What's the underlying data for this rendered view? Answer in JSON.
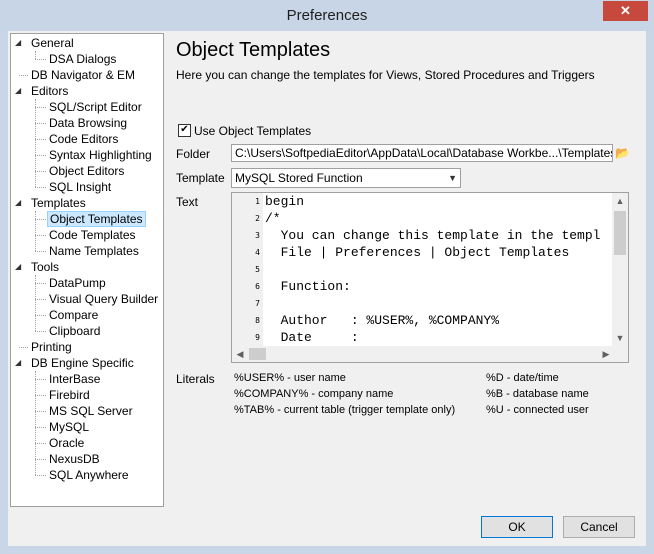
{
  "window": {
    "title": "Preferences",
    "close_glyph": "✕"
  },
  "tree": {
    "items": [
      {
        "label": "General",
        "level": 0,
        "expanded": true
      },
      {
        "label": "DSA Dialogs",
        "level": 1
      },
      {
        "label": "DB Navigator & EM",
        "level": 0
      },
      {
        "label": "Editors",
        "level": 0,
        "expanded": true
      },
      {
        "label": "SQL/Script Editor",
        "level": 1
      },
      {
        "label": "Data Browsing",
        "level": 1
      },
      {
        "label": "Code Editors",
        "level": 1
      },
      {
        "label": "Syntax Highlighting",
        "level": 1
      },
      {
        "label": "Object Editors",
        "level": 1
      },
      {
        "label": "SQL Insight",
        "level": 1
      },
      {
        "label": "Templates",
        "level": 0,
        "expanded": true
      },
      {
        "label": "Object Templates",
        "level": 1,
        "selected": true
      },
      {
        "label": "Code Templates",
        "level": 1
      },
      {
        "label": "Name Templates",
        "level": 1
      },
      {
        "label": "Tools",
        "level": 0,
        "expanded": true
      },
      {
        "label": "DataPump",
        "level": 1
      },
      {
        "label": "Visual Query Builder",
        "level": 1
      },
      {
        "label": "Compare",
        "level": 1
      },
      {
        "label": "Clipboard",
        "level": 1
      },
      {
        "label": "Printing",
        "level": 0
      },
      {
        "label": "DB Engine Specific",
        "level": 0,
        "expanded": true
      },
      {
        "label": "InterBase",
        "level": 1
      },
      {
        "label": "Firebird",
        "level": 1
      },
      {
        "label": "MS SQL Server",
        "level": 1
      },
      {
        "label": "MySQL",
        "level": 1
      },
      {
        "label": "Oracle",
        "level": 1
      },
      {
        "label": "NexusDB",
        "level": 1
      },
      {
        "label": "SQL Anywhere",
        "level": 1
      }
    ]
  },
  "main": {
    "heading": "Object Templates",
    "description": "Here you can change the templates for Views, Stored Procedures and Triggers",
    "use_templates": {
      "label": "Use Object Templates",
      "checked": true,
      "check_glyph": "✔"
    },
    "folder": {
      "label": "Folder",
      "value": "C:\\Users\\SoftpediaEditor\\AppData\\Local\\Database Workbe...\\Templates\\"
    },
    "template": {
      "label": "Template",
      "value": "MySQL Stored Function"
    },
    "text": {
      "label": "Text",
      "line_numbers": [
        "1",
        "2",
        "3",
        "4",
        "5",
        "6",
        "7",
        "8",
        "9"
      ],
      "lines": [
        "begin",
        "/*",
        "  You can change this template in the templ",
        "  File | Preferences | Object Templates",
        "",
        "  Function:",
        "",
        "  Author   : %USER%, %COMPANY%",
        "  Date     :"
      ]
    },
    "literals": {
      "label": "Literals",
      "left": [
        "%USER% - user name",
        "%COMPANY% - company name",
        "%TAB% - current table (trigger template only)"
      ],
      "right": [
        "%D - date/time",
        "%B - database name",
        "%U - connected user"
      ]
    }
  },
  "buttons": {
    "ok": "OK",
    "cancel": "Cancel"
  },
  "icons": {
    "folder": "folder-open-icon",
    "dropdown": "chevron-down-icon"
  }
}
